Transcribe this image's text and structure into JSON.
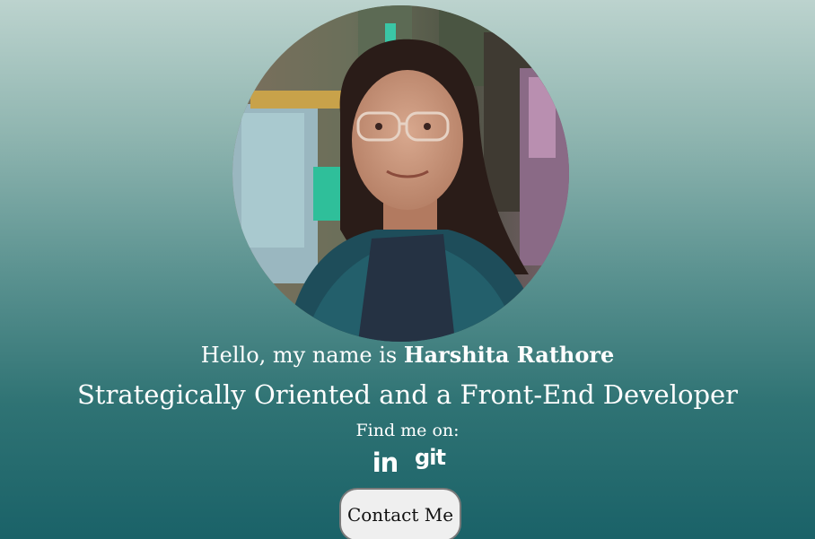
{
  "profile": {
    "greeting_prefix": "Hello, my name is ",
    "name": "Harshita Rathore",
    "tagline": "Strategically Oriented and a Front-End Developer",
    "find_me": "Find me on:"
  },
  "socials": [
    {
      "label": "in",
      "icon": "linkedin-icon"
    },
    {
      "label": "git",
      "icon": "github-icon"
    }
  ],
  "contact": {
    "label": "Contact Me"
  },
  "colors": {
    "gradient_top": "#bcd3ce",
    "gradient_bottom": "#1a6268",
    "button_bg": "#efefef",
    "button_border": "#7a7a7a"
  }
}
